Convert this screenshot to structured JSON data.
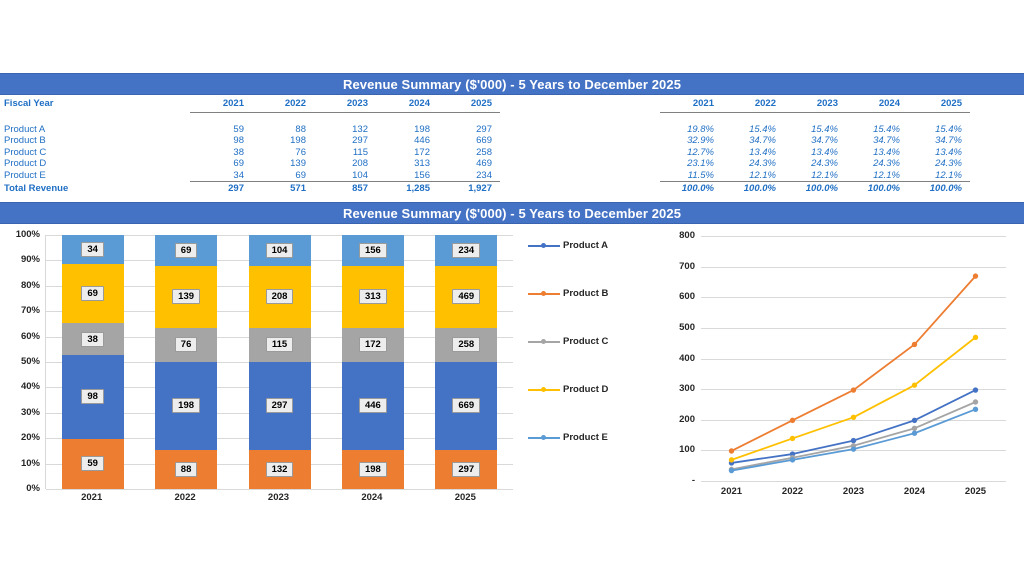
{
  "titles": {
    "top": "Revenue Summary ($'000) - 5 Years to December 2025",
    "bottom": "Revenue Summary ($'000) - 5 Years to December 2025"
  },
  "table": {
    "row_header_label": "Fiscal Year",
    "years": [
      "2021",
      "2022",
      "2023",
      "2024",
      "2025"
    ],
    "total_label": "Total Revenue",
    "values": {
      "headers": [
        "2021",
        "2022",
        "2023",
        "2024",
        "2025"
      ],
      "rows": [
        {
          "label": "Product A",
          "cells": [
            "59",
            "88",
            "132",
            "198",
            "297"
          ]
        },
        {
          "label": "Product B",
          "cells": [
            "98",
            "198",
            "297",
            "446",
            "669"
          ]
        },
        {
          "label": "Product C",
          "cells": [
            "38",
            "76",
            "115",
            "172",
            "258"
          ]
        },
        {
          "label": "Product D",
          "cells": [
            "69",
            "139",
            "208",
            "313",
            "469"
          ]
        },
        {
          "label": "Product E",
          "cells": [
            "34",
            "69",
            "104",
            "156",
            "234"
          ]
        }
      ],
      "total": [
        "297",
        "571",
        "857",
        "1,285",
        "1,927"
      ]
    },
    "percents": {
      "headers": [
        "2021",
        "2022",
        "2023",
        "2024",
        "2025"
      ],
      "rows": [
        {
          "label": "",
          "cells": [
            "19.8%",
            "15.4%",
            "15.4%",
            "15.4%",
            "15.4%"
          ]
        },
        {
          "label": "",
          "cells": [
            "32.9%",
            "34.7%",
            "34.7%",
            "34.7%",
            "34.7%"
          ]
        },
        {
          "label": "",
          "cells": [
            "12.7%",
            "13.4%",
            "13.4%",
            "13.4%",
            "13.4%"
          ]
        },
        {
          "label": "",
          "cells": [
            "23.1%",
            "24.3%",
            "24.3%",
            "24.3%",
            "24.3%"
          ]
        },
        {
          "label": "",
          "cells": [
            "11.5%",
            "12.1%",
            "12.1%",
            "12.1%",
            "12.1%"
          ]
        }
      ],
      "total": [
        "100.0%",
        "100.0%",
        "100.0%",
        "100.0%",
        "100.0%"
      ]
    }
  },
  "legend": {
    "items": [
      {
        "label": "Product A",
        "color": "#4472C4"
      },
      {
        "label": "Product B",
        "color": "#ED7D31"
      },
      {
        "label": "Product C",
        "color": "#A5A5A5"
      },
      {
        "label": "Product D",
        "color": "#FFC000"
      },
      {
        "label": "Product E",
        "color": "#5B9BD5"
      }
    ]
  },
  "colors": {
    "title_bar": "#4472C4",
    "table_text": "#1F6FC4",
    "product_a": "#4472C4",
    "product_b": "#ED7D31",
    "product_c": "#A5A5A5",
    "product_d": "#FFC000",
    "product_e": "#5B9BD5",
    "gridline": "#D9D9D9"
  },
  "chart_data": [
    {
      "type": "bar",
      "id": "stacked-percent-bar",
      "title": "Revenue Summary ($'000) - 5 Years to December 2025",
      "stacked": true,
      "normalized": "100%",
      "categories": [
        "2021",
        "2022",
        "2023",
        "2024",
        "2025"
      ],
      "ylabel": "",
      "xlabel": "",
      "ylim": [
        0,
        100
      ],
      "ytick_labels": [
        "0%",
        "10%",
        "20%",
        "30%",
        "40%",
        "50%",
        "60%",
        "70%",
        "80%",
        "90%",
        "100%"
      ],
      "grid": true,
      "legend_position": "right",
      "series": [
        {
          "name": "Product B",
          "color": "#ED7D31",
          "values": [
            59,
            88,
            132,
            198,
            297
          ],
          "percents": [
            19.8,
            15.4,
            15.4,
            15.4,
            15.4
          ]
        },
        {
          "name": "Product A",
          "color": "#4472C4",
          "values": [
            98,
            198,
            297,
            446,
            669
          ],
          "percents": [
            32.9,
            34.7,
            34.7,
            34.7,
            34.7
          ]
        },
        {
          "name": "Product C",
          "color": "#A5A5A5",
          "values": [
            38,
            76,
            115,
            172,
            258
          ],
          "percents": [
            12.7,
            13.4,
            13.4,
            13.4,
            13.4
          ]
        },
        {
          "name": "Product D",
          "color": "#FFC000",
          "values": [
            69,
            139,
            208,
            313,
            469
          ],
          "percents": [
            23.1,
            24.3,
            24.3,
            24.3,
            24.3
          ]
        },
        {
          "name": "Product E",
          "color": "#5B9BD5",
          "values": [
            34,
            69,
            104,
            156,
            234
          ],
          "percents": [
            11.5,
            12.1,
            12.1,
            12.1,
            12.1
          ]
        }
      ],
      "data_labels": [
        [
          "59",
          "88",
          "132",
          "198",
          "297"
        ],
        [
          "98",
          "198",
          "297",
          "446",
          "669"
        ],
        [
          "38",
          "76",
          "115",
          "172",
          "258"
        ],
        [
          "69",
          "139",
          "208",
          "313",
          "469"
        ],
        [
          "34",
          "69",
          "104",
          "156",
          "234"
        ]
      ]
    },
    {
      "type": "line",
      "id": "revenue-trend-line",
      "title": "",
      "x": [
        "2021",
        "2022",
        "2023",
        "2024",
        "2025"
      ],
      "ylim": [
        0,
        800
      ],
      "ytick_labels": [
        "-",
        "100",
        "200",
        "300",
        "400",
        "500",
        "600",
        "700",
        "800"
      ],
      "grid": true,
      "markers": true,
      "legend_position": "left",
      "series": [
        {
          "name": "Product A",
          "color": "#4472C4",
          "values": [
            59,
            88,
            132,
            198,
            297
          ]
        },
        {
          "name": "Product B",
          "color": "#ED7D31",
          "values": [
            98,
            198,
            297,
            446,
            669
          ]
        },
        {
          "name": "Product C",
          "color": "#A5A5A5",
          "values": [
            38,
            76,
            115,
            172,
            258
          ]
        },
        {
          "name": "Product D",
          "color": "#FFC000",
          "values": [
            69,
            139,
            208,
            313,
            469
          ]
        },
        {
          "name": "Product E",
          "color": "#5B9BD5",
          "values": [
            34,
            69,
            104,
            156,
            234
          ]
        }
      ]
    }
  ]
}
